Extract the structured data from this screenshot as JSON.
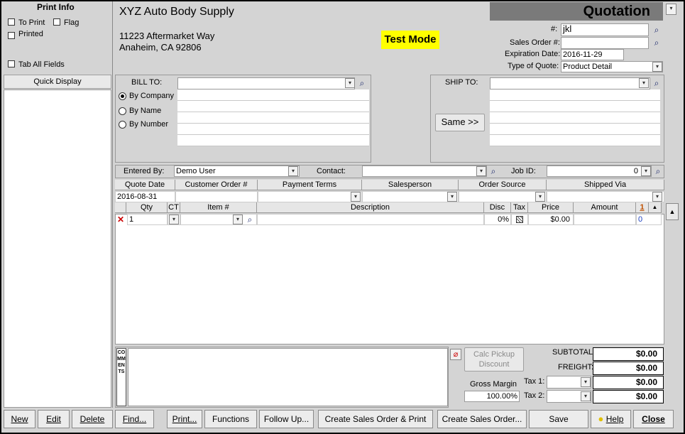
{
  "print_info": {
    "title": "Print Info",
    "to_print": "To Print",
    "flag": "Flag",
    "printed": "Printed",
    "tab_all_fields": "Tab All Fields",
    "quick_display": "Quick Display"
  },
  "company": {
    "name": "XYZ Auto Body Supply",
    "address1": "11223 Aftermarket Way",
    "address2": "Anaheim, CA 92806"
  },
  "test_mode": "Test Mode",
  "doc_title": "Quotation",
  "header_fields": {
    "number_label": "#:",
    "number_value": "jkl",
    "sales_order_label": "Sales Order #:",
    "expiration_label": "Expiration Date:",
    "expiration_value": "2016-11-29",
    "type_label": "Type of Quote:",
    "type_value": "Product Detail"
  },
  "bill_to": {
    "label": "BILL TO:",
    "options": [
      "By Company",
      "By Name",
      "By Number"
    ]
  },
  "ship_to": {
    "label": "SHIP TO:",
    "same_button": "Same >>"
  },
  "entry": {
    "entered_by_label": "Entered By:",
    "entered_by_value": "Demo User",
    "contact_label": "Contact:",
    "job_id_label": "Job ID:",
    "job_id_value": "0"
  },
  "order_headers": [
    "Quote Date",
    "Customer Order #",
    "Payment Terms",
    "Salesperson",
    "Order Source",
    "Shipped Via"
  ],
  "quote_date": "2016-08-31",
  "line_headers": {
    "qty": "Qty",
    "ct": "CT",
    "item": "Item #",
    "description": "Description",
    "disc": "Disc",
    "tax": "Tax",
    "price": "Price",
    "amount": "Amount",
    "flag": "1"
  },
  "line_row": {
    "qty": "1",
    "disc": "0%",
    "price": "$0.00",
    "amount": "0"
  },
  "comments_label": "COMMENTS",
  "calc_pickup": "Calc Pickup Discount",
  "gross_margin": {
    "label": "Gross Margin",
    "value": "100.00%"
  },
  "totals": {
    "subtotal_label": "SUBTOTAL:",
    "subtotal": "$0.00",
    "freight_label": "FREIGHT:",
    "freight": "$0.00",
    "tax1_label": "Tax 1:",
    "tax1": "$0.00",
    "tax2_label": "Tax 2:",
    "tax2": "$0.00"
  },
  "bottom_buttons": [
    "New",
    "Edit",
    "Delete",
    "Find...",
    "Print...",
    "Functions",
    "Follow Up...",
    "Create Sales Order & Print",
    "Create Sales Order...",
    "Save",
    "Help",
    "Close"
  ]
}
